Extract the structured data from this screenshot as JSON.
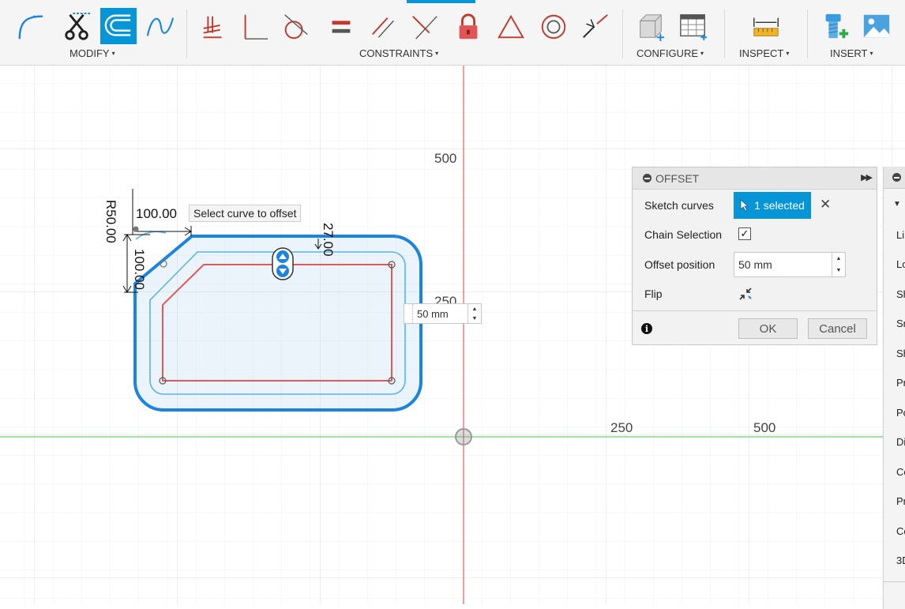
{
  "toolbar": {
    "groups": [
      {
        "label": "MODIFY",
        "caret": "▾"
      },
      {
        "label": "CONSTRAINTS",
        "caret": "▾"
      },
      {
        "label": "CONFIGURE",
        "caret": "▾"
      },
      {
        "label": "INSPECT",
        "caret": "▾"
      },
      {
        "label": "INSERT",
        "caret": "▾"
      }
    ],
    "modify_icons": [
      "fillet-icon",
      "trim-icon",
      "offset-icon",
      "spline-icon"
    ],
    "constraint_icons": [
      "fix-icon",
      "perpendicular-icon",
      "tangent-icon",
      "equal-icon",
      "parallel-icon",
      "coincident-icon",
      "lock-icon",
      "triangle-icon",
      "concentric-icon",
      "collinear-icon"
    ],
    "configure_icons": [
      "configure-box-icon",
      "table-icon"
    ],
    "inspect_icons": [
      "measure-icon"
    ],
    "insert_icons": [
      "bolt-icon",
      "image-icon"
    ]
  },
  "canvas": {
    "axis_labels": {
      "y500": "500",
      "y250": "250",
      "x250": "250",
      "x500": "500"
    },
    "tooltip": "Select curve to offset",
    "dims": {
      "radius": "R50.00",
      "horizontal": "100.00",
      "vertical": "100.00",
      "offset": "27.00"
    },
    "inline_input": "50 mm"
  },
  "offset_panel": {
    "title": "OFFSET",
    "sketch_curves_label": "Sketch curves",
    "selected_text": "1 selected",
    "chain_selection_label": "Chain Selection",
    "chain_selection_checked": "✓",
    "offset_position_label": "Offset position",
    "offset_position_value": "50 mm",
    "flip_label": "Flip",
    "ok_label": "OK",
    "cancel_label": "Cancel",
    "info_glyph": "i"
  },
  "side_panel": {
    "items": [
      "Li",
      "Lo",
      "Sh",
      "Sn",
      "Sh",
      "Pr",
      "Po",
      "Di",
      "Co",
      "Pr",
      "Co",
      "3D"
    ]
  },
  "colors": {
    "accent": "#0696d7",
    "x_axis": "#6ad06a",
    "y_axis": "#e06060",
    "profile": "#1a84e0",
    "offset_curve": "#e05a5a"
  }
}
